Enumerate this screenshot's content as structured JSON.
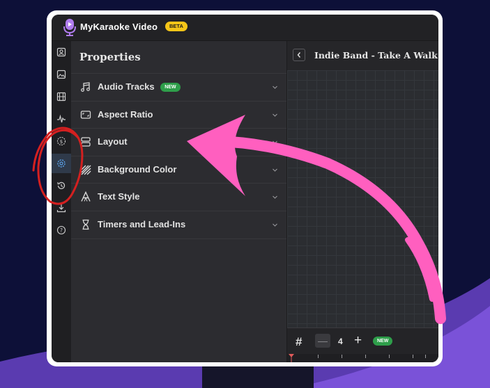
{
  "app": {
    "title": "MyKaraoke Video",
    "badge": "BETA"
  },
  "rail": {
    "items": [
      {
        "name": "profile-icon"
      },
      {
        "name": "image-icon"
      },
      {
        "name": "film-icon"
      },
      {
        "name": "waveform-icon"
      },
      {
        "name": "dollar-circle-icon"
      },
      {
        "name": "settings-icon",
        "active": true
      },
      {
        "name": "history-icon"
      },
      {
        "name": "download-icon"
      },
      {
        "name": "help-icon"
      }
    ]
  },
  "properties": {
    "title": "Properties",
    "items": [
      {
        "label": "Audio Tracks",
        "icon": "music-note-icon",
        "badge": "NEW"
      },
      {
        "label": "Aspect Ratio",
        "icon": "aspect-ratio-icon"
      },
      {
        "label": "Layout",
        "icon": "layout-icon"
      },
      {
        "label": "Background Color",
        "icon": "background-pattern-icon"
      },
      {
        "label": "Text Style",
        "icon": "text-style-icon"
      },
      {
        "label": "Timers and Lead-Ins",
        "icon": "hourglass-icon"
      }
    ]
  },
  "preview": {
    "title": "Indie Band - Take A Walk",
    "grid_count": "4",
    "new_badge": "NEW"
  },
  "colors": {
    "accent_pink": "#ff5fbf",
    "annotation_red": "#d42020",
    "beta_yellow": "#f5c518",
    "new_green": "#2e9e4a",
    "active_icon": "#5aa0e6"
  }
}
